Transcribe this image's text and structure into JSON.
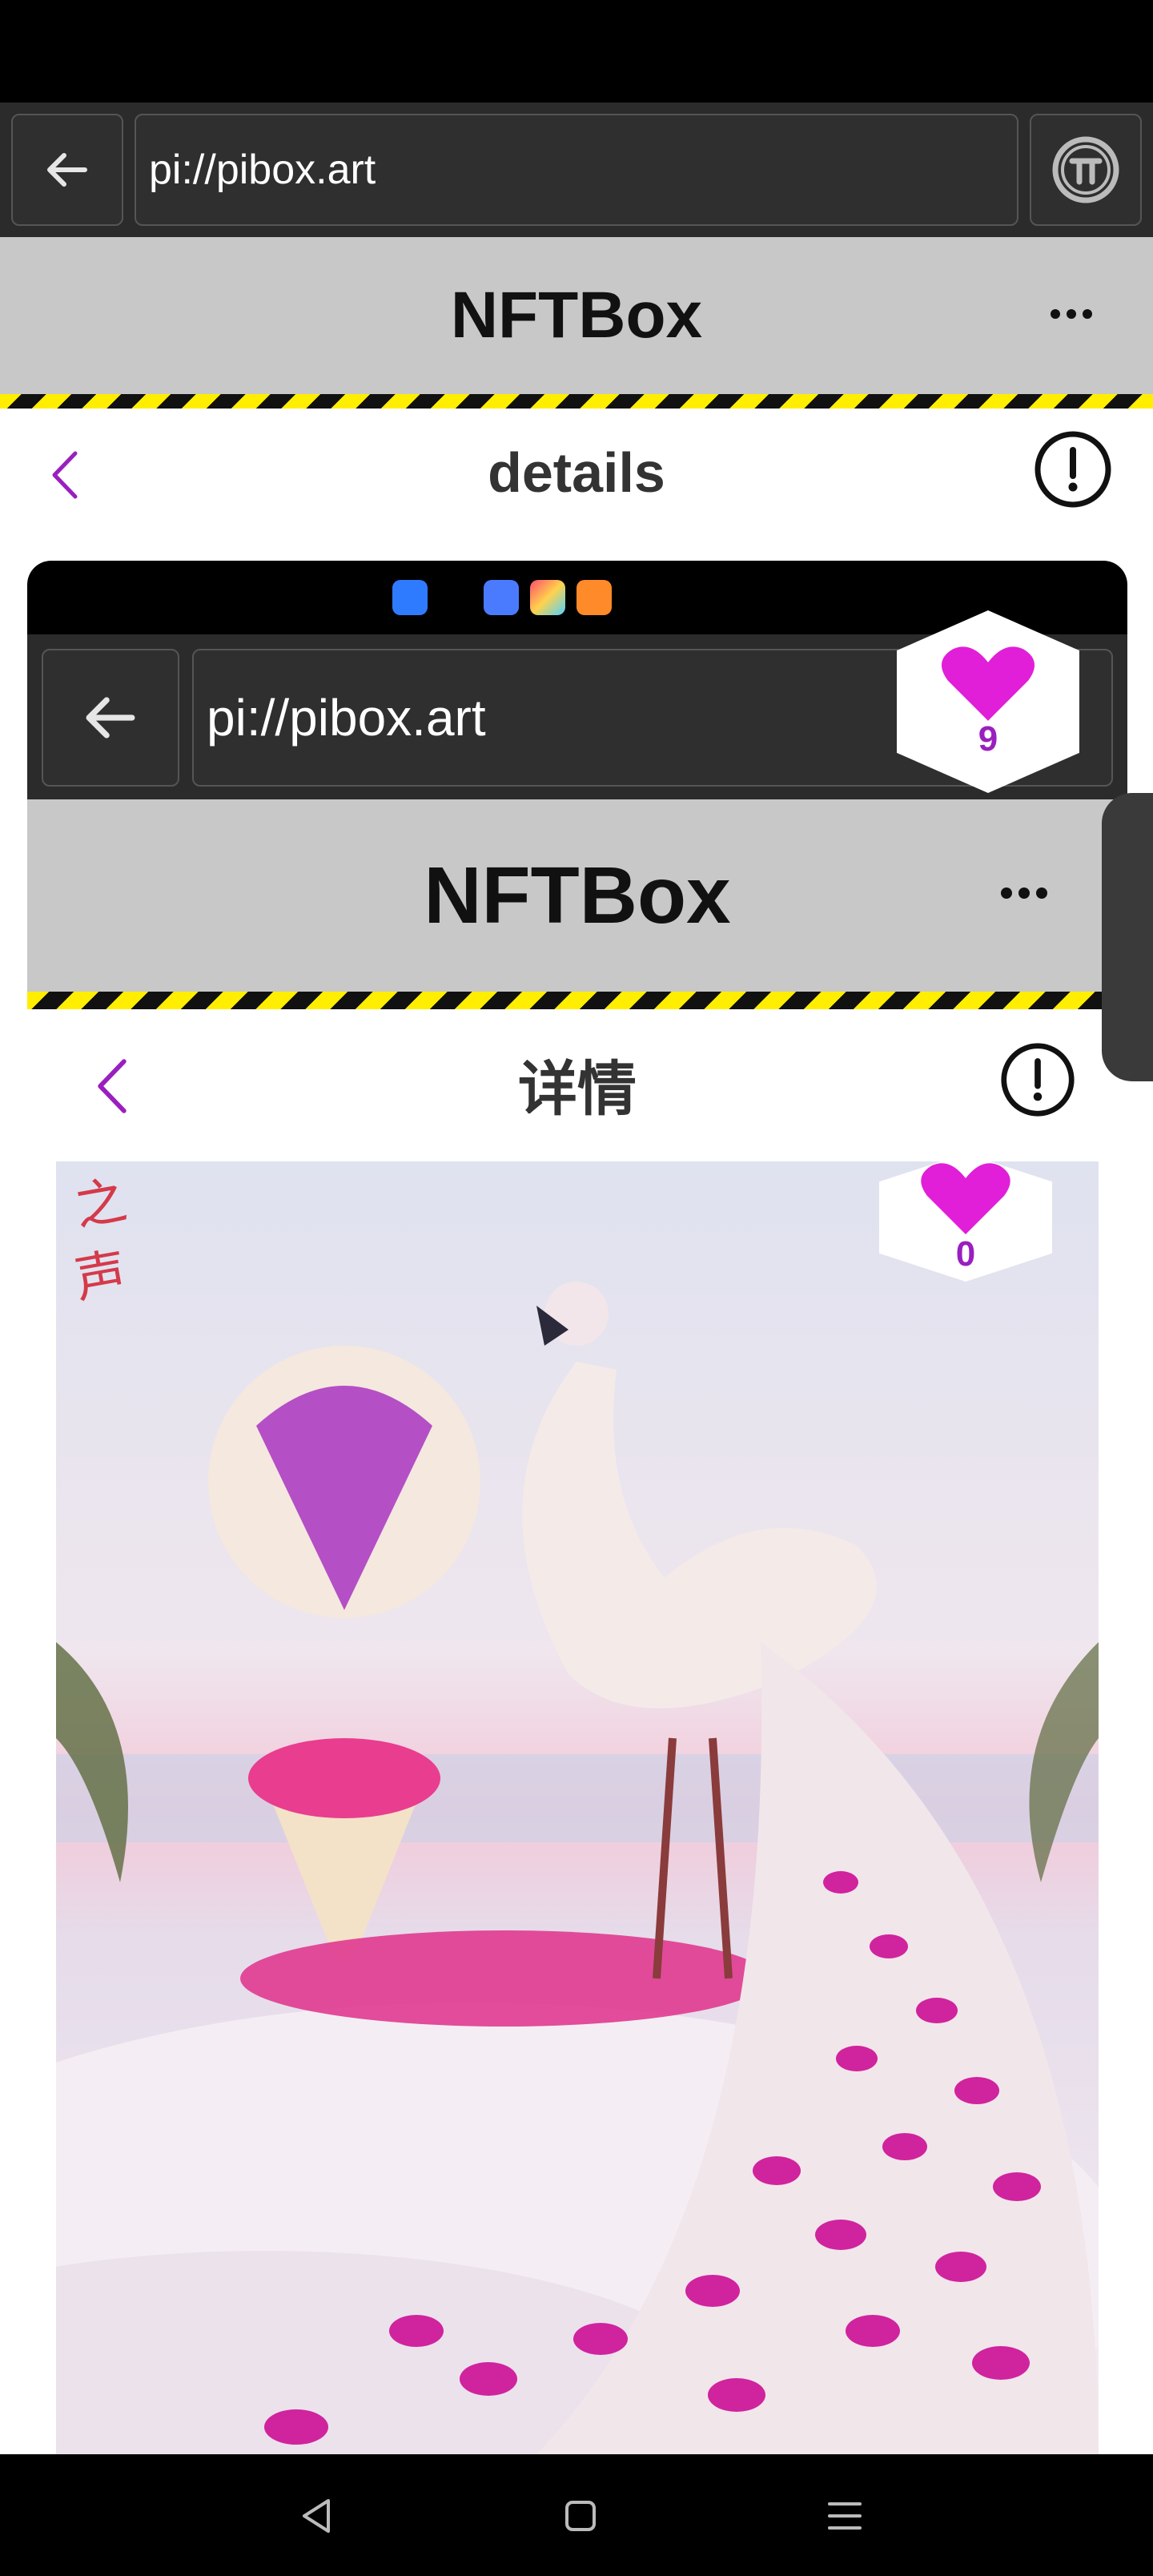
{
  "browser": {
    "url": "pi://pibox.art",
    "back_icon": "arrow-left-icon",
    "pi_icon": "pi-logo-icon"
  },
  "app": {
    "title": "NFTBox",
    "more_icon": "more-horizontal-icon"
  },
  "subheader": {
    "title": "details",
    "back_icon": "chevron-left-icon",
    "info_icon": "exclamation-circle-icon"
  },
  "preview": {
    "status_app_icons": [
      "cloud-app-icon",
      "music-app-icon",
      "photos-app-icon",
      "video-app-icon"
    ],
    "browser": {
      "url": "pi://pibox.art"
    },
    "app": {
      "title": "NFTBox"
    },
    "subheader": {
      "title": "详情"
    },
    "like_count_outer": "9",
    "like_count_inner": "0",
    "artwork_seal_text": "之声"
  },
  "system_nav": {
    "back": "triangle-back-icon",
    "home": "square-home-icon",
    "menu": "hamburger-menu-icon"
  },
  "colors": {
    "accent": "#9a1fbf",
    "heart": "#e11fd8",
    "hazard_yellow": "#ffee00"
  }
}
